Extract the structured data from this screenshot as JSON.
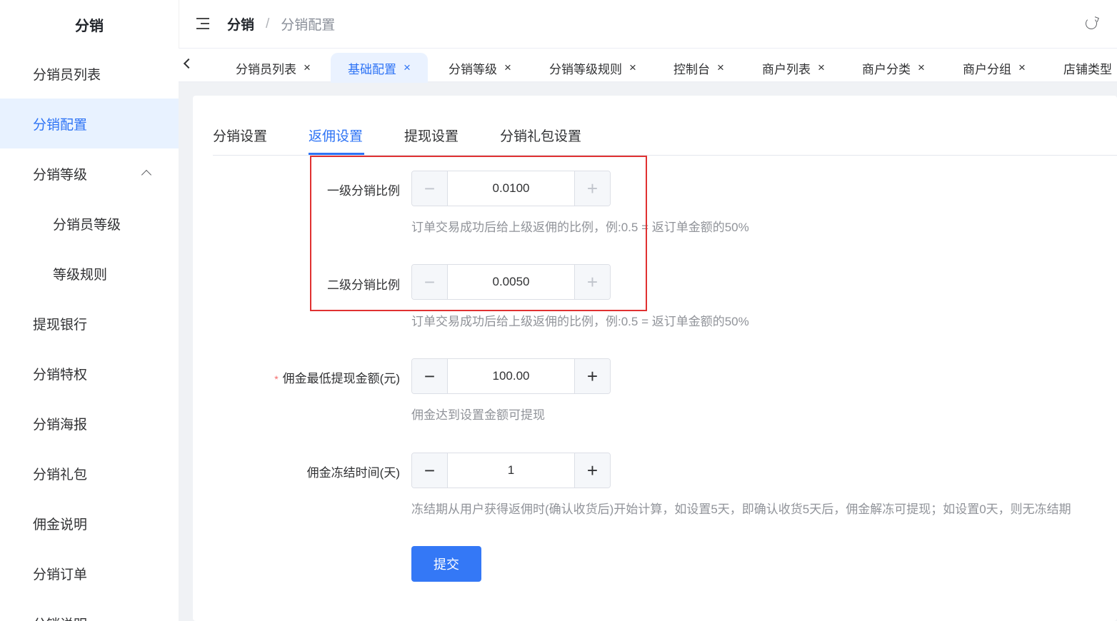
{
  "sidebar": {
    "title": "分销",
    "items": [
      {
        "label": "分销员列表"
      },
      {
        "label": "分销配置"
      },
      {
        "label": "分销等级"
      },
      {
        "label": "分销员等级"
      },
      {
        "label": "等级规则"
      },
      {
        "label": "提现银行"
      },
      {
        "label": "分销特权"
      },
      {
        "label": "分销海报"
      },
      {
        "label": "分销礼包"
      },
      {
        "label": "佣金说明"
      },
      {
        "label": "分销订单"
      },
      {
        "label": "分销说明"
      }
    ],
    "active_item": "分销配置"
  },
  "header": {
    "breadcrumb": {
      "current": "分销",
      "separator": "/",
      "page": "分销配置"
    }
  },
  "tabs": [
    {
      "label": "分销员列表",
      "close": "×"
    },
    {
      "label": "基础配置",
      "close": "×"
    },
    {
      "label": "分销等级",
      "close": "×"
    },
    {
      "label": "分销等级规则",
      "close": "×"
    },
    {
      "label": "控制台",
      "close": "×"
    },
    {
      "label": "商户列表",
      "close": "×"
    },
    {
      "label": "商户分类",
      "close": "×"
    },
    {
      "label": "商户分组",
      "close": "×"
    },
    {
      "label": "店铺类型",
      "close": ""
    }
  ],
  "active_tab": "基础配置",
  "form_tabs": [
    {
      "label": "分销设置"
    },
    {
      "label": "返佣设置"
    },
    {
      "label": "提现设置"
    },
    {
      "label": "分销礼包设置"
    }
  ],
  "active_form_tab": "返佣设置",
  "form": {
    "level1": {
      "label": "一级分销比例",
      "value": "0.0100",
      "hint": "订单交易成功后给上级返佣的比例，例:0.5 = 返订单金额的50%"
    },
    "level2": {
      "label": "二级分销比例",
      "value": "0.0050",
      "hint": "订单交易成功后给上级返佣的比例，例:0.5 = 返订单金额的50%"
    },
    "min_withdraw": {
      "required_mark": "*",
      "label": "佣金最低提现金额(元)",
      "value": "100.00",
      "hint": "佣金达到设置金额可提现"
    },
    "freeze_days": {
      "label": "佣金冻结时间(天)",
      "value": "1",
      "hint": "冻结期从用户获得返佣时(确认收货后)开始计算，如设置5天，即确认收货5天后，佣金解冻可提现；如设置0天，则无冻结期"
    },
    "minus_glyph": "−",
    "plus_glyph": "+",
    "submit_label": "提交"
  },
  "colors": {
    "accent": "#2d73f5",
    "highlight_box": "#e03131",
    "required": "#f56c6c"
  },
  "icons": [
    "menu-fold-icon",
    "refresh-icon",
    "chevron-up-icon",
    "chevron-left-icon",
    "close-icon"
  ]
}
